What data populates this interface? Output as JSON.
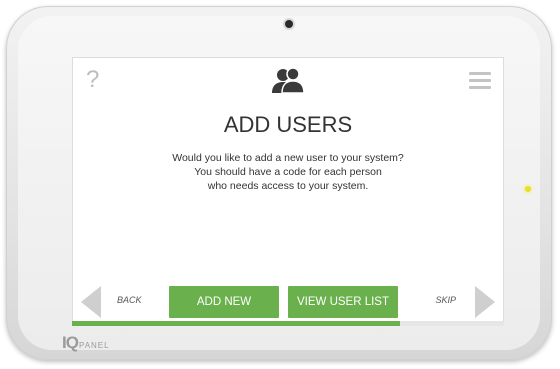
{
  "header": {
    "help_icon": "question-mark-icon",
    "help_glyph": "?",
    "users_icon": "users-icon",
    "menu_icon": "hamburger-menu-icon"
  },
  "main": {
    "title": "ADD USERS",
    "description_lines": [
      "Would you like to add a new user to your system?",
      "You should have a code for each person",
      "who needs access to your system."
    ]
  },
  "footer": {
    "back_label": "BACK",
    "add_new_label": "ADD NEW",
    "view_user_list_label": "VIEW USER LIST",
    "skip_label": "SKIP",
    "progress_fraction": 0.76
  },
  "device": {
    "brand_iq": "IQ",
    "brand_panel": "PANEL",
    "accent_color": "#6ab04c",
    "led_color": "#e8e021"
  }
}
